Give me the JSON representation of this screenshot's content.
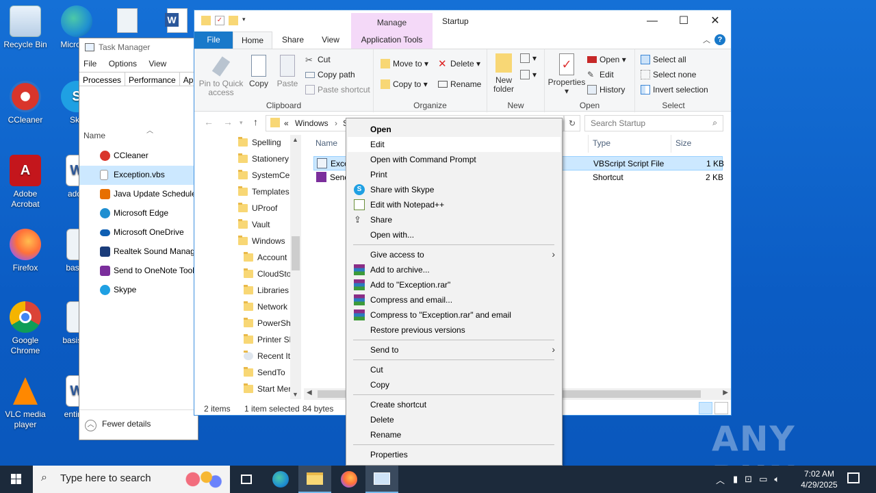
{
  "desktop": {
    "icons": [
      {
        "label": "Recycle Bin"
      },
      {
        "label": "Micro Ed"
      },
      {
        "label": "CCleaner"
      },
      {
        "label": "Sky"
      },
      {
        "label": "Adobe Acrobat"
      },
      {
        "label": "addfi"
      },
      {
        "label": "Firefox"
      },
      {
        "label": "basict"
      },
      {
        "label": "Google Chrome"
      },
      {
        "label": "basispa"
      },
      {
        "label": "VLC media player"
      },
      {
        "label": "entireb"
      }
    ],
    "watermark": "ANY RUN"
  },
  "task_manager": {
    "title": "Task Manager",
    "menu": [
      "File",
      "Options",
      "View"
    ],
    "tabs": [
      "Processes",
      "Performance",
      "App"
    ],
    "column_name": "Name",
    "startup_items": [
      {
        "name": "CCleaner",
        "icon": "ccleaner-icon",
        "color": "#d9352b"
      },
      {
        "name": "Exception.vbs",
        "icon": "document-icon",
        "color": "#ffffff"
      },
      {
        "name": "Java Update Scheduler",
        "icon": "java-icon",
        "color": "#e76f00"
      },
      {
        "name": "Microsoft Edge",
        "icon": "edge-icon",
        "color": "#1f8fd1"
      },
      {
        "name": "Microsoft OneDrive",
        "icon": "onedrive-icon",
        "color": "#0f5fb3"
      },
      {
        "name": "Realtek Sound Manager",
        "icon": "realtek-icon",
        "color": "#1a3c7a"
      },
      {
        "name": "Send to OneNote Tool",
        "icon": "onenote-icon",
        "color": "#7b2e9c"
      },
      {
        "name": "Skype",
        "icon": "skype-icon",
        "color": "#1fa0e3"
      }
    ],
    "selected_item": "Exception.vbs",
    "fewer_details": "Fewer details"
  },
  "explorer": {
    "title": "Startup",
    "manage_label": "Manage",
    "ribbon_tabs": {
      "file": "File",
      "home": "Home",
      "share": "Share",
      "view": "View",
      "app_tools": "Application Tools"
    },
    "clipboard": {
      "group": "Clipboard",
      "pin": "Pin to Quick access",
      "copy": "Copy",
      "paste": "Paste",
      "cut": "Cut",
      "copy_path": "Copy path",
      "paste_shortcut": "Paste shortcut"
    },
    "organize": {
      "group": "Organize",
      "move_to": "Move to",
      "copy_to": "Copy to",
      "delete": "Delete",
      "rename": "Rename"
    },
    "new": {
      "group": "New",
      "new_folder": "New folder"
    },
    "open": {
      "group": "Open",
      "properties": "Properties",
      "open": "Open",
      "edit": "Edit",
      "history": "History"
    },
    "select": {
      "group": "Select",
      "select_all": "Select all",
      "select_none": "Select none",
      "invert": "Invert selection"
    },
    "address": {
      "prefix": "«",
      "crumb": "Windows",
      "crumb2": "S"
    },
    "search_placeholder": "Search Startup",
    "nav_items": [
      {
        "label": "Spelling"
      },
      {
        "label": "Stationery"
      },
      {
        "label": "SystemCer"
      },
      {
        "label": "Templates"
      },
      {
        "label": "UProof"
      },
      {
        "label": "Vault"
      },
      {
        "label": "Windows"
      },
      {
        "label": "Account"
      },
      {
        "label": "CloudSto"
      },
      {
        "label": "Libraries"
      },
      {
        "label": "Network"
      },
      {
        "label": "PowerSh"
      },
      {
        "label": "Printer Sh"
      },
      {
        "label": "Recent It"
      },
      {
        "label": "SendTo"
      },
      {
        "label": "Start Mer"
      }
    ],
    "columns": {
      "name": "Name",
      "type": "Type",
      "size": "Size"
    },
    "files": [
      {
        "name": "Exce",
        "type": "VBScript Script File",
        "size": "1 KB"
      },
      {
        "name": "Send",
        "type": "Shortcut",
        "size": "2 KB"
      }
    ],
    "status": {
      "items": "2 items",
      "selected": "1 item selected",
      "bytes": "84 bytes"
    }
  },
  "context_menu": {
    "items": [
      {
        "label": "Open"
      },
      {
        "label": "Edit"
      },
      {
        "label": "Open with Command Prompt"
      },
      {
        "label": "Print"
      },
      {
        "label": "Share with Skype"
      },
      {
        "label": "Edit with Notepad++"
      },
      {
        "label": "Share"
      },
      {
        "label": "Open with..."
      },
      {
        "label": "Give access to"
      },
      {
        "label": "Add to archive..."
      },
      {
        "label": "Add to \"Exception.rar\""
      },
      {
        "label": "Compress and email..."
      },
      {
        "label": "Compress to \"Exception.rar\" and email"
      },
      {
        "label": "Restore previous versions"
      },
      {
        "label": "Send to"
      },
      {
        "label": "Cut"
      },
      {
        "label": "Copy"
      },
      {
        "label": "Create shortcut"
      },
      {
        "label": "Delete"
      },
      {
        "label": "Rename"
      },
      {
        "label": "Properties"
      }
    ],
    "highlighted": "Edit"
  },
  "taskbar": {
    "search_placeholder": "Type here to search",
    "time": "7:02 AM",
    "date": "4/29/2025"
  },
  "colors": {
    "accent": "#1979ca",
    "selection": "#cce8ff",
    "taskbar": "#1c2a3b",
    "desktop": "#0b5cc4"
  }
}
